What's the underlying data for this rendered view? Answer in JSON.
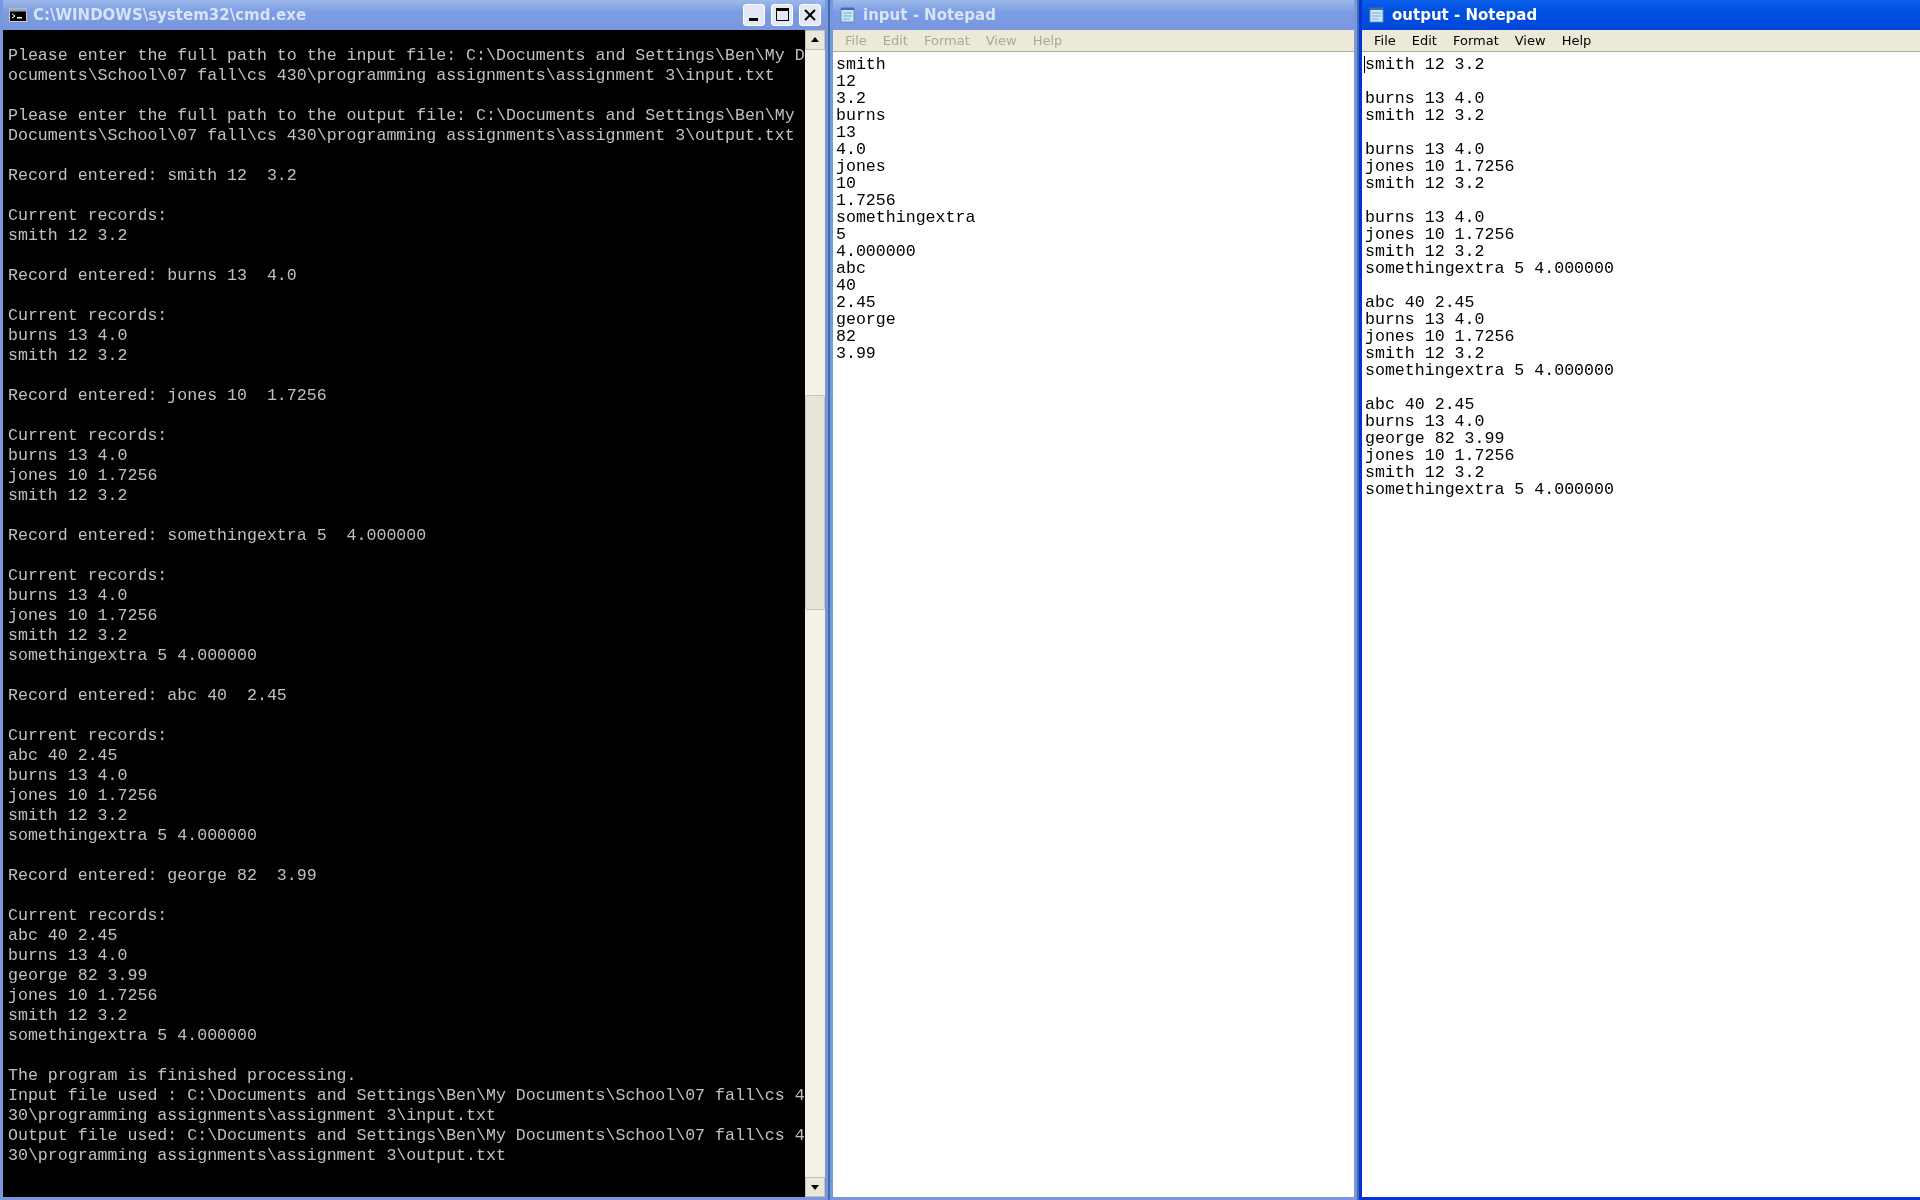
{
  "console": {
    "title": "C:\\WINDOWS\\system32\\cmd.exe",
    "active": false,
    "blocks": [
      [
        "Please enter the full path to the input file: C:\\Documents and Settings\\Ben\\My D",
        "ocuments\\School\\07 fall\\cs 430\\programming assignments\\assignment 3\\input.txt"
      ],
      [
        "Please enter the full path to the output file: C:\\Documents and Settings\\Ben\\My",
        "Documents\\School\\07 fall\\cs 430\\programming assignments\\assignment 3\\output.txt"
      ],
      [
        "Record entered: smith 12  3.2"
      ],
      [
        "Current records:",
        "smith 12 3.2"
      ],
      [
        "Record entered: burns 13  4.0"
      ],
      [
        "Current records:",
        "burns 13 4.0",
        "smith 12 3.2"
      ],
      [
        "Record entered: jones 10  1.7256"
      ],
      [
        "Current records:",
        "burns 13 4.0",
        "jones 10 1.7256",
        "smith 12 3.2"
      ],
      [
        "Record entered: somethingextra 5  4.000000"
      ],
      [
        "Current records:",
        "burns 13 4.0",
        "jones 10 1.7256",
        "smith 12 3.2",
        "somethingextra 5 4.000000"
      ],
      [
        "Record entered: abc 40  2.45"
      ],
      [
        "Current records:",
        "abc 40 2.45",
        "burns 13 4.0",
        "jones 10 1.7256",
        "smith 12 3.2",
        "somethingextra 5 4.000000"
      ],
      [
        "Record entered: george 82  3.99"
      ],
      [
        "Current records:",
        "abc 40 2.45",
        "burns 13 4.0",
        "george 82 3.99",
        "jones 10 1.7256",
        "smith 12 3.2",
        "somethingextra 5 4.000000"
      ],
      [
        "The program is finished processing.",
        "Input file used : C:\\Documents and Settings\\Ben\\My Documents\\School\\07 fall\\cs 4",
        "30\\programming assignments\\assignment 3\\input.txt",
        "Output file used: C:\\Documents and Settings\\Ben\\My Documents\\School\\07 fall\\cs 4",
        "30\\programming assignments\\assignment 3\\output.txt"
      ]
    ]
  },
  "notepads": [
    {
      "title": "input - Notepad",
      "active": false,
      "menu": [
        "File",
        "Edit",
        "Format",
        "View",
        "Help"
      ],
      "blocks": [
        [
          "smith",
          "12",
          "3.2",
          "burns",
          "13",
          "4.0",
          "jones",
          "10",
          "1.7256",
          "somethingextra",
          "5",
          "4.000000",
          "abc",
          "40",
          "2.45",
          "george",
          "82",
          "3.99"
        ]
      ]
    },
    {
      "title": "output - Notepad",
      "active": true,
      "menu": [
        "File",
        "Edit",
        "Format",
        "View",
        "Help"
      ],
      "blocks": [
        [
          "smith 12 3.2"
        ],
        [
          "burns 13 4.0",
          "smith 12 3.2"
        ],
        [
          "burns 13 4.0",
          "jones 10 1.7256",
          "smith 12 3.2"
        ],
        [
          "burns 13 4.0",
          "jones 10 1.7256",
          "smith 12 3.2",
          "somethingextra 5 4.000000"
        ],
        [
          "abc 40 2.45",
          "burns 13 4.0",
          "jones 10 1.7256",
          "smith 12 3.2",
          "somethingextra 5 4.000000"
        ],
        [
          "abc 40 2.45",
          "burns 13 4.0",
          "george 82 3.99",
          "jones 10 1.7256",
          "smith 12 3.2",
          "somethingextra 5 4.000000"
        ]
      ]
    }
  ]
}
